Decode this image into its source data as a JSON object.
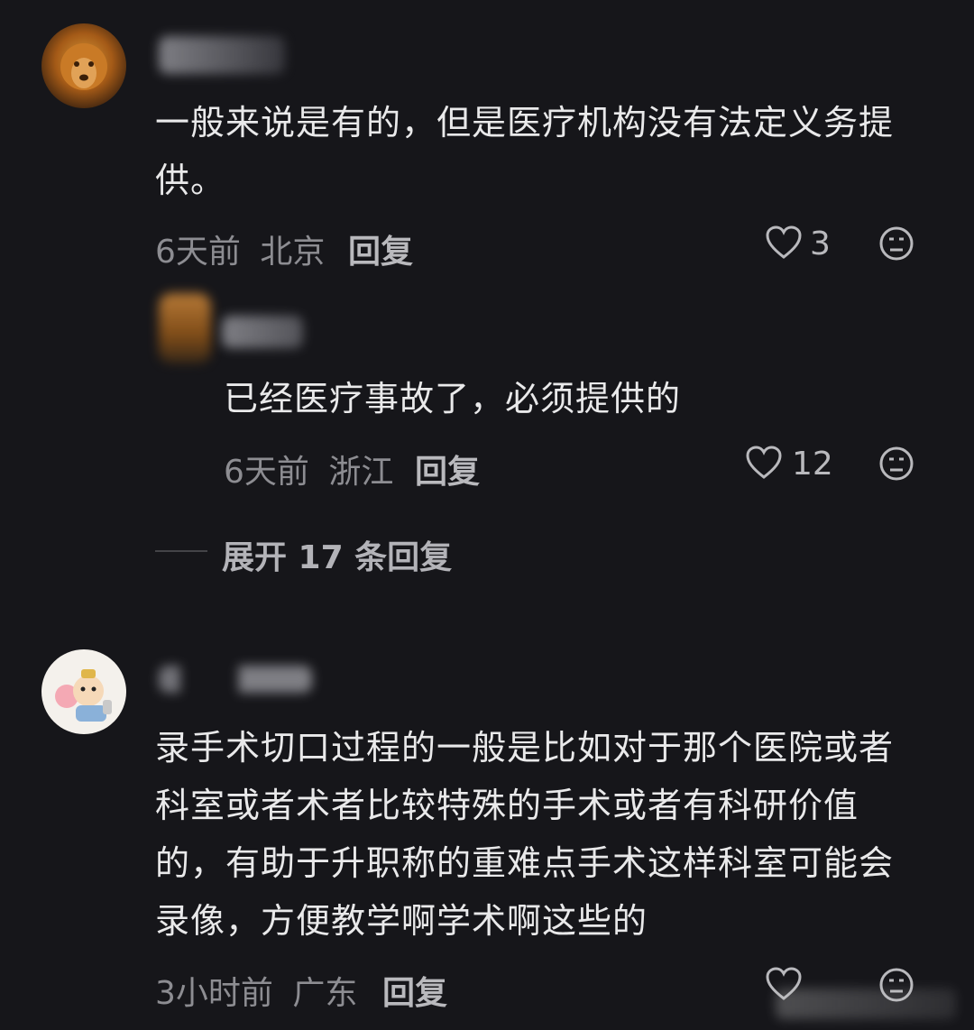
{
  "comments": [
    {
      "text": "一般来说是有的，但是医疗机构没有法定义务提供。",
      "time": "6天前",
      "location": "北京",
      "reply_label": "回复",
      "likes": "3",
      "replies": [
        {
          "text": "已经医疗事故了，必须提供的",
          "time": "6天前",
          "location": "浙江",
          "reply_label": "回复",
          "likes": "12"
        }
      ],
      "expand_label": "展开 17 条回复"
    },
    {
      "text": "录手术切口过程的一般是比如对于那个医院或者科室或者术者比较特殊的手术或者有科研价值的，有助于升职称的重难点手术这样科室可能会录像，方便教学啊学术啊这些的",
      "time": "3小时前",
      "location": "广东",
      "reply_label": "回复"
    }
  ],
  "icons": {
    "like": "heart-outline-icon",
    "dislike": "meh-face-icon"
  },
  "colors": {
    "background": "#16161a",
    "text": "#e9e9ea",
    "meta": "#8d8d92"
  }
}
